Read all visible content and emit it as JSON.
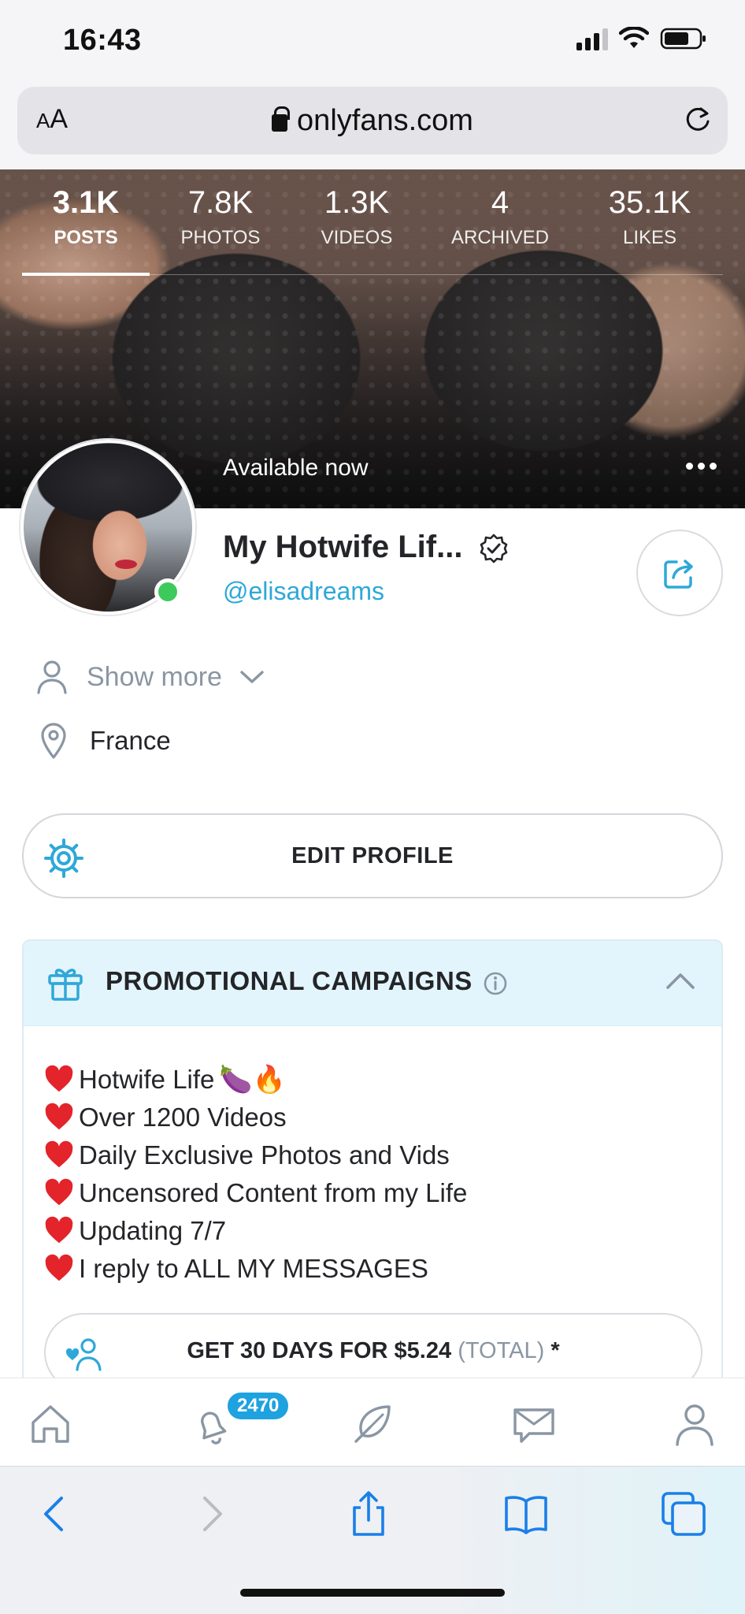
{
  "status_bar": {
    "time": "16:43"
  },
  "browser": {
    "text_size_label": "AA",
    "url": "onlyfans.com"
  },
  "cover": {
    "stats": [
      {
        "value": "3.1K",
        "label": "POSTS",
        "active": true
      },
      {
        "value": "7.8K",
        "label": "PHOTOS",
        "active": false
      },
      {
        "value": "1.3K",
        "label": "VIDEOS",
        "active": false
      },
      {
        "value": "4",
        "label": "ARCHIVED",
        "active": false
      },
      {
        "value": "35.1K",
        "label": "LIKES",
        "active": false
      }
    ],
    "availability": "Available now"
  },
  "profile": {
    "name": "My Hotwife Lif...",
    "handle": "@elisadreams",
    "show_more": "Show more",
    "location": "France",
    "edit_button": "EDIT PROFILE"
  },
  "promo": {
    "title": "PROMOTIONAL CAMPAIGNS",
    "lines": [
      {
        "text": " Hotwife Life",
        "emoji": "🍆🔥"
      },
      {
        "text": "Over 1200 Videos",
        "emoji": ""
      },
      {
        "text": "Daily Exclusive Photos and Vids",
        "emoji": ""
      },
      {
        "text": "Uncensored Content from my Life",
        "emoji": ""
      },
      {
        "text": "Updating 7/7",
        "emoji": ""
      },
      {
        "text": "I reply to ALL MY MESSAGES",
        "emoji": ""
      }
    ],
    "offer_main": "GET 30 DAYS FOR $5.24",
    "offer_muted": "(TOTAL)",
    "offer_suffix": "*"
  },
  "app_nav": {
    "notifications_badge": "2470"
  },
  "colors": {
    "accent": "#00aff0",
    "link": "#2ea8d8",
    "online": "#3cca5a",
    "heart": "#e3242b",
    "promo_header_bg": "#e3f5fc"
  }
}
